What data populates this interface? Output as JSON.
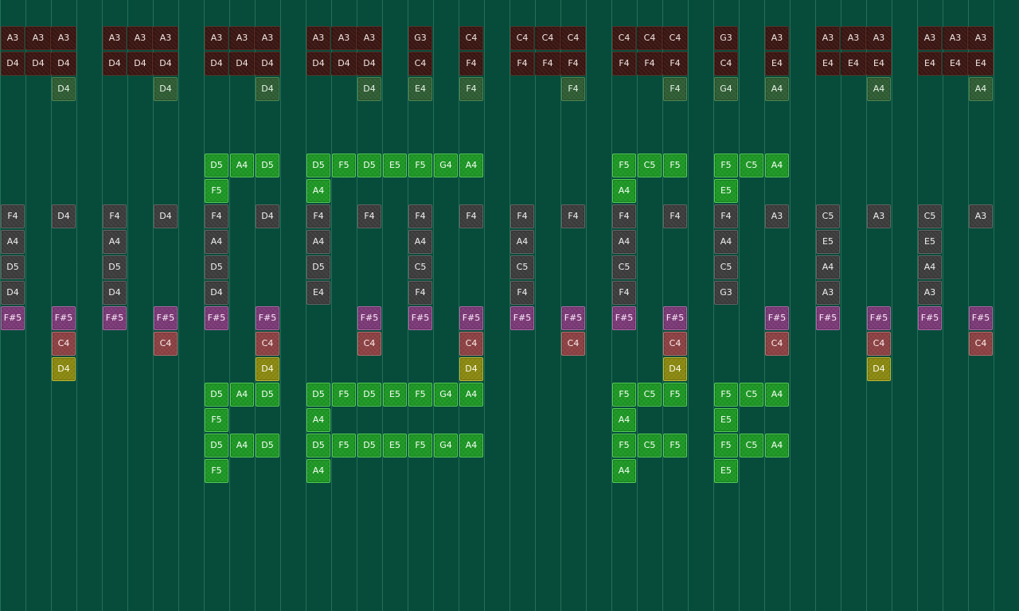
{
  "app": {
    "view": "note-grid",
    "colors": {
      "background": "#074c3b",
      "gridline": "#2f7a63",
      "bass": "#3b1612",
      "pad": "#2f5e34",
      "lead": "#1d9a25",
      "chord": "#3e3d3d",
      "accent": "#7d3a78",
      "hit": "#8f4244",
      "bell": "#8d8b10"
    }
  },
  "tracks": [
    {
      "name": "bass-high",
      "type": "bass",
      "row": 0,
      "notes": [
        {
          "col": 0,
          "label": "A3"
        },
        {
          "col": 1,
          "label": "A3"
        },
        {
          "col": 2,
          "label": "A3"
        },
        {
          "col": 4,
          "label": "A3"
        },
        {
          "col": 5,
          "label": "A3"
        },
        {
          "col": 6,
          "label": "A3"
        },
        {
          "col": 8,
          "label": "A3"
        },
        {
          "col": 9,
          "label": "A3"
        },
        {
          "col": 10,
          "label": "A3"
        },
        {
          "col": 12,
          "label": "A3"
        },
        {
          "col": 13,
          "label": "A3"
        },
        {
          "col": 14,
          "label": "A3"
        },
        {
          "col": 16,
          "label": "G3"
        },
        {
          "col": 18,
          "label": "C4"
        },
        {
          "col": 20,
          "label": "C4"
        },
        {
          "col": 21,
          "label": "C4"
        },
        {
          "col": 22,
          "label": "C4"
        },
        {
          "col": 24,
          "label": "C4"
        },
        {
          "col": 25,
          "label": "C4"
        },
        {
          "col": 26,
          "label": "C4"
        },
        {
          "col": 28,
          "label": "G3"
        },
        {
          "col": 30,
          "label": "A3"
        },
        {
          "col": 32,
          "label": "A3"
        },
        {
          "col": 33,
          "label": "A3"
        },
        {
          "col": 34,
          "label": "A3"
        },
        {
          "col": 36,
          "label": "A3"
        },
        {
          "col": 37,
          "label": "A3"
        },
        {
          "col": 38,
          "label": "A3"
        }
      ]
    },
    {
      "name": "bass-low",
      "type": "bass",
      "row": 1,
      "notes": [
        {
          "col": 0,
          "label": "D4"
        },
        {
          "col": 1,
          "label": "D4"
        },
        {
          "col": 2,
          "label": "D4"
        },
        {
          "col": 4,
          "label": "D4"
        },
        {
          "col": 5,
          "label": "D4"
        },
        {
          "col": 6,
          "label": "D4"
        },
        {
          "col": 8,
          "label": "D4"
        },
        {
          "col": 9,
          "label": "D4"
        },
        {
          "col": 10,
          "label": "D4"
        },
        {
          "col": 12,
          "label": "D4"
        },
        {
          "col": 13,
          "label": "D4"
        },
        {
          "col": 14,
          "label": "D4"
        },
        {
          "col": 16,
          "label": "C4"
        },
        {
          "col": 18,
          "label": "F4"
        },
        {
          "col": 20,
          "label": "F4"
        },
        {
          "col": 21,
          "label": "F4"
        },
        {
          "col": 22,
          "label": "F4"
        },
        {
          "col": 24,
          "label": "F4"
        },
        {
          "col": 25,
          "label": "F4"
        },
        {
          "col": 26,
          "label": "F4"
        },
        {
          "col": 28,
          "label": "C4"
        },
        {
          "col": 30,
          "label": "E4"
        },
        {
          "col": 32,
          "label": "E4"
        },
        {
          "col": 33,
          "label": "E4"
        },
        {
          "col": 34,
          "label": "E4"
        },
        {
          "col": 36,
          "label": "E4"
        },
        {
          "col": 37,
          "label": "E4"
        },
        {
          "col": 38,
          "label": "E4"
        }
      ]
    },
    {
      "name": "pad",
      "type": "pad",
      "row": 2,
      "notes": [
        {
          "col": 2,
          "label": "D4"
        },
        {
          "col": 6,
          "label": "D4"
        },
        {
          "col": 10,
          "label": "D4"
        },
        {
          "col": 14,
          "label": "D4"
        },
        {
          "col": 16,
          "label": "E4"
        },
        {
          "col": 18,
          "label": "F4"
        },
        {
          "col": 22,
          "label": "F4"
        },
        {
          "col": 26,
          "label": "F4"
        },
        {
          "col": 28,
          "label": "G4"
        },
        {
          "col": 30,
          "label": "A4"
        },
        {
          "col": 34,
          "label": "A4"
        },
        {
          "col": 38,
          "label": "A4"
        }
      ]
    },
    {
      "name": "lead-a1",
      "type": "lead",
      "row": 5,
      "notes": [
        {
          "col": 8,
          "label": "D5"
        },
        {
          "col": 9,
          "label": "A4"
        },
        {
          "col": 10,
          "label": "D5"
        },
        {
          "col": 12,
          "label": "D5"
        },
        {
          "col": 13,
          "label": "F5"
        },
        {
          "col": 14,
          "label": "D5"
        },
        {
          "col": 15,
          "label": "E5"
        },
        {
          "col": 16,
          "label": "F5"
        },
        {
          "col": 17,
          "label": "G4"
        },
        {
          "col": 18,
          "label": "A4"
        },
        {
          "col": 24,
          "label": "F5"
        },
        {
          "col": 25,
          "label": "C5"
        },
        {
          "col": 26,
          "label": "F5"
        },
        {
          "col": 28,
          "label": "F5"
        },
        {
          "col": 29,
          "label": "C5"
        },
        {
          "col": 30,
          "label": "A4"
        }
      ]
    },
    {
      "name": "lead-a2",
      "type": "lead",
      "row": 6,
      "notes": [
        {
          "col": 8,
          "label": "F5"
        },
        {
          "col": 12,
          "label": "A4"
        },
        {
          "col": 24,
          "label": "A4"
        },
        {
          "col": 28,
          "label": "E5"
        }
      ]
    },
    {
      "name": "chord-1",
      "type": "chord",
      "row": 7,
      "notes": [
        {
          "col": 0,
          "label": "F4"
        },
        {
          "col": 2,
          "label": "D4"
        },
        {
          "col": 4,
          "label": "F4"
        },
        {
          "col": 6,
          "label": "D4"
        },
        {
          "col": 8,
          "label": "F4"
        },
        {
          "col": 10,
          "label": "D4"
        },
        {
          "col": 12,
          "label": "F4"
        },
        {
          "col": 14,
          "label": "F4"
        },
        {
          "col": 16,
          "label": "F4"
        },
        {
          "col": 18,
          "label": "F4"
        },
        {
          "col": 20,
          "label": "F4"
        },
        {
          "col": 22,
          "label": "F4"
        },
        {
          "col": 24,
          "label": "F4"
        },
        {
          "col": 26,
          "label": "F4"
        },
        {
          "col": 28,
          "label": "F4"
        },
        {
          "col": 30,
          "label": "A3"
        },
        {
          "col": 32,
          "label": "C5"
        },
        {
          "col": 34,
          "label": "A3"
        },
        {
          "col": 36,
          "label": "C5"
        },
        {
          "col": 38,
          "label": "A3"
        }
      ]
    },
    {
      "name": "chord-2",
      "type": "chord",
      "row": 8,
      "notes": [
        {
          "col": 0,
          "label": "A4"
        },
        {
          "col": 4,
          "label": "A4"
        },
        {
          "col": 8,
          "label": "A4"
        },
        {
          "col": 12,
          "label": "A4"
        },
        {
          "col": 16,
          "label": "A4"
        },
        {
          "col": 20,
          "label": "A4"
        },
        {
          "col": 24,
          "label": "A4"
        },
        {
          "col": 28,
          "label": "A4"
        },
        {
          "col": 32,
          "label": "E5"
        },
        {
          "col": 36,
          "label": "E5"
        }
      ]
    },
    {
      "name": "chord-3",
      "type": "chord",
      "row": 9,
      "notes": [
        {
          "col": 0,
          "label": "D5"
        },
        {
          "col": 4,
          "label": "D5"
        },
        {
          "col": 8,
          "label": "D5"
        },
        {
          "col": 12,
          "label": "D5"
        },
        {
          "col": 16,
          "label": "C5"
        },
        {
          "col": 20,
          "label": "C5"
        },
        {
          "col": 24,
          "label": "C5"
        },
        {
          "col": 28,
          "label": "C5"
        },
        {
          "col": 32,
          "label": "A4"
        },
        {
          "col": 36,
          "label": "A4"
        }
      ]
    },
    {
      "name": "chord-4",
      "type": "chord",
      "row": 10,
      "notes": [
        {
          "col": 0,
          "label": "D4"
        },
        {
          "col": 4,
          "label": "D4"
        },
        {
          "col": 8,
          "label": "D4"
        },
        {
          "col": 12,
          "label": "E4"
        },
        {
          "col": 16,
          "label": "F4"
        },
        {
          "col": 20,
          "label": "F4"
        },
        {
          "col": 24,
          "label": "F4"
        },
        {
          "col": 28,
          "label": "G3"
        },
        {
          "col": 32,
          "label": "A3"
        },
        {
          "col": 36,
          "label": "A3"
        }
      ]
    },
    {
      "name": "accent",
      "type": "accent",
      "row": 11,
      "notes": [
        {
          "col": 0,
          "label": "F#5"
        },
        {
          "col": 2,
          "label": "F#5"
        },
        {
          "col": 4,
          "label": "F#5"
        },
        {
          "col": 6,
          "label": "F#5"
        },
        {
          "col": 8,
          "label": "F#5"
        },
        {
          "col": 10,
          "label": "F#5"
        },
        {
          "col": 14,
          "label": "F#5"
        },
        {
          "col": 16,
          "label": "F#5"
        },
        {
          "col": 18,
          "label": "F#5"
        },
        {
          "col": 20,
          "label": "F#5"
        },
        {
          "col": 22,
          "label": "F#5"
        },
        {
          "col": 24,
          "label": "F#5"
        },
        {
          "col": 26,
          "label": "F#5"
        },
        {
          "col": 30,
          "label": "F#5"
        },
        {
          "col": 32,
          "label": "F#5"
        },
        {
          "col": 34,
          "label": "F#5"
        },
        {
          "col": 36,
          "label": "F#5"
        },
        {
          "col": 38,
          "label": "F#5"
        }
      ]
    },
    {
      "name": "hit",
      "type": "hit",
      "row": 12,
      "notes": [
        {
          "col": 2,
          "label": "C4"
        },
        {
          "col": 6,
          "label": "C4"
        },
        {
          "col": 10,
          "label": "C4"
        },
        {
          "col": 14,
          "label": "C4"
        },
        {
          "col": 18,
          "label": "C4"
        },
        {
          "col": 22,
          "label": "C4"
        },
        {
          "col": 26,
          "label": "C4"
        },
        {
          "col": 30,
          "label": "C4"
        },
        {
          "col": 34,
          "label": "C4"
        },
        {
          "col": 38,
          "label": "C4"
        }
      ]
    },
    {
      "name": "bell",
      "type": "bell",
      "row": 13,
      "notes": [
        {
          "col": 2,
          "label": "D4"
        },
        {
          "col": 10,
          "label": "D4"
        },
        {
          "col": 18,
          "label": "D4"
        },
        {
          "col": 26,
          "label": "D4"
        },
        {
          "col": 34,
          "label": "D4"
        }
      ]
    },
    {
      "name": "lead-b1",
      "type": "lead",
      "row": 14,
      "notes": [
        {
          "col": 8,
          "label": "D5"
        },
        {
          "col": 9,
          "label": "A4"
        },
        {
          "col": 10,
          "label": "D5"
        },
        {
          "col": 12,
          "label": "D5"
        },
        {
          "col": 13,
          "label": "F5"
        },
        {
          "col": 14,
          "label": "D5"
        },
        {
          "col": 15,
          "label": "E5"
        },
        {
          "col": 16,
          "label": "F5"
        },
        {
          "col": 17,
          "label": "G4"
        },
        {
          "col": 18,
          "label": "A4"
        },
        {
          "col": 24,
          "label": "F5"
        },
        {
          "col": 25,
          "label": "C5"
        },
        {
          "col": 26,
          "label": "F5"
        },
        {
          "col": 28,
          "label": "F5"
        },
        {
          "col": 29,
          "label": "C5"
        },
        {
          "col": 30,
          "label": "A4"
        }
      ]
    },
    {
      "name": "lead-b2",
      "type": "lead",
      "row": 15,
      "notes": [
        {
          "col": 8,
          "label": "F5"
        },
        {
          "col": 12,
          "label": "A4"
        },
        {
          "col": 24,
          "label": "A4"
        },
        {
          "col": 28,
          "label": "E5"
        }
      ]
    },
    {
      "name": "lead-c1",
      "type": "lead",
      "row": 16,
      "notes": [
        {
          "col": 8,
          "label": "D5"
        },
        {
          "col": 9,
          "label": "A4"
        },
        {
          "col": 10,
          "label": "D5"
        },
        {
          "col": 12,
          "label": "D5"
        },
        {
          "col": 13,
          "label": "F5"
        },
        {
          "col": 14,
          "label": "D5"
        },
        {
          "col": 15,
          "label": "E5"
        },
        {
          "col": 16,
          "label": "F5"
        },
        {
          "col": 17,
          "label": "G4"
        },
        {
          "col": 18,
          "label": "A4"
        },
        {
          "col": 24,
          "label": "F5"
        },
        {
          "col": 25,
          "label": "C5"
        },
        {
          "col": 26,
          "label": "F5"
        },
        {
          "col": 28,
          "label": "F5"
        },
        {
          "col": 29,
          "label": "C5"
        },
        {
          "col": 30,
          "label": "A4"
        }
      ]
    },
    {
      "name": "lead-c2",
      "type": "lead",
      "row": 17,
      "notes": [
        {
          "col": 8,
          "label": "F5"
        },
        {
          "col": 12,
          "label": "A4"
        },
        {
          "col": 24,
          "label": "A4"
        },
        {
          "col": 28,
          "label": "E5"
        }
      ]
    }
  ]
}
